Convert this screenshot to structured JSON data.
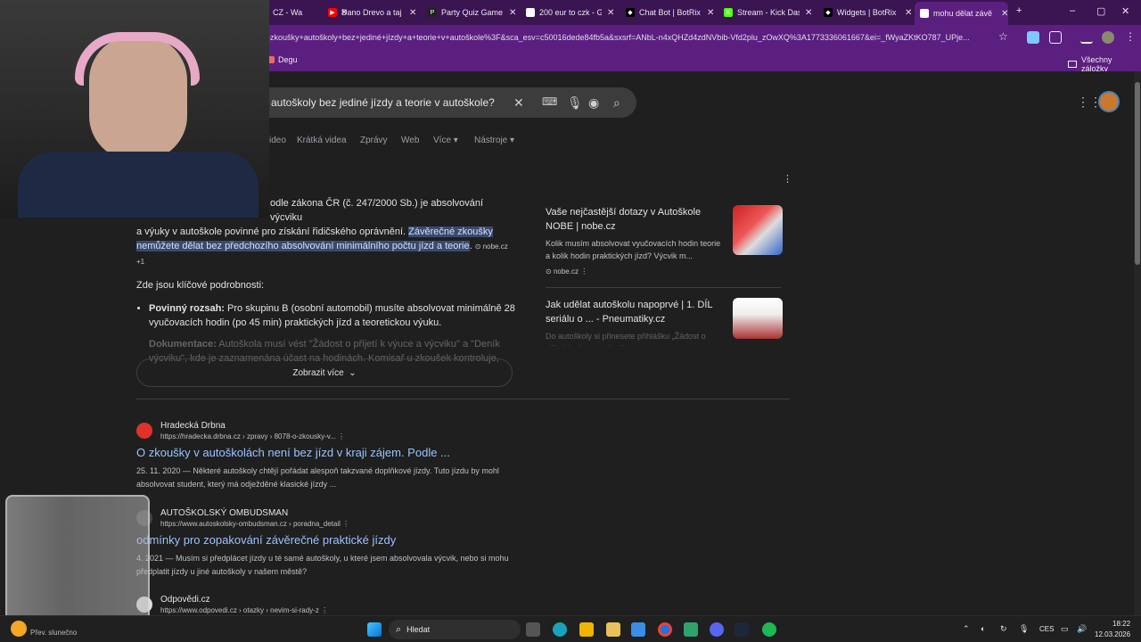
{
  "tabs": [
    {
      "title": "CZ - Wa",
      "color": "#6d4c8a",
      "glyph": ""
    },
    {
      "title": "Dano Drevo a taj",
      "color": "#ff0000",
      "glyph": "▶"
    },
    {
      "title": "Party Quiz Game",
      "color": "#222222",
      "glyph": "P"
    },
    {
      "title": "200 eur to czk - G",
      "color": "#ffffff",
      "glyph": "G"
    },
    {
      "title": "Chat Bot | BotRix",
      "color": "#000000",
      "glyph": "◆"
    },
    {
      "title": "Stream - Kick Das",
      "color": "#53fc18",
      "glyph": "K"
    },
    {
      "title": "Widgets | BotRix",
      "color": "#000000",
      "glyph": "◆"
    },
    {
      "title": "mohu dělat závě",
      "color": "#ffffff",
      "glyph": "G"
    }
  ],
  "new_tab_glyph": "+",
  "window_controls": [
    "–",
    "▢",
    "✕"
  ],
  "address_bar": {
    "url": "-zkoušky+autoškoly+bez+jediné+jízdy+a+teorie+v+autoškole%3F&sca_esv=c50016dede84fb5a&sxsrf=ANbL-n4xQHZd4zdNVbib-Vfd2plu_zOwXQ%3A1773336061667&ei=_fWyaZKtKO787_UPje..."
  },
  "bookmarks": {
    "left": "Degu",
    "right": "Všechny záložky"
  },
  "search": {
    "query": "autoškoly bez jediné jízdy a teorie v autoškole?"
  },
  "filters": [
    "ideo",
    "Krátká videa",
    "Zprávy",
    "Web",
    "Více",
    "Nástroje"
  ],
  "overview": {
    "line1": "odle zákona ČR (č. 247/2000 Sb.) je absolvování výcviku",
    "line2_plain": "a výuky v autoškole povinné pro získání řidičského oprávnění.",
    "highlight": "Závěrečné zkoušky nemůžete dělat bez předchozího absolvování minimálního počtu jízd a teorie",
    "highlight_end": ".",
    "source_chip": "nobe.cz +1",
    "subhead": "Zde jsou klíčové podrobnosti:",
    "bullets": [
      {
        "label": "Povinný rozsah:",
        "text": "Pro skupinu B (osobní automobil) musíte absolvovat minimálně 28 vyučovacích hodin (po 45 min) praktických jízd a teoretickou výuku."
      },
      {
        "label": "Dokumentace:",
        "text": "Autoškola musí vést \"Žádost o přijetí k výuce a výcviku\" a \"Deník výcviku\", kde je zaznamenána účast na hodinách. Komisař u zkoušek kontroluje, zda"
      }
    ],
    "show_more": "Zobrazit více"
  },
  "side_cards": [
    {
      "title": "Vaše nejčastější dotazy v Autoškole NOBE | nobe.cz",
      "snippet": "Kolik musím absolvovat vyučovacích hodin teorie a kolik hodin praktických jízd? Výcvik m...",
      "source": "nobe.cz"
    },
    {
      "title": "Jak udělat autoškolu napoprvé | 1. DÍL seriálu o ... - Pneumatiky.cz",
      "snippet": "Do autoškoly si přinesete přihlášku „Žádost o přijetí k výuce a výcviku..."
    }
  ],
  "results": [
    {
      "site": "Hradecká Drbna",
      "url": "https://hradecka.drbna.cz › zpravy › 8078-o-zkousky-v...",
      "title": "O zkoušky v autoškolách není bez jízd v kraji zájem. Podle ...",
      "snippet": "25. 11. 2020 — Některé autoškoly chtějí pořádat alespoň takzvané doplňkové jízdy. Tuto jízdu by mohl absolvovat student, který má odježděné klasické jízdy ..."
    },
    {
      "site": "AUTOŠKOLSKÝ OMBUDSMAN",
      "url": "https://www.autoskolsky-ombudsman.cz › poradna_detail",
      "title": "odmínky pro zopakování závěrečné praktické jízdy",
      "snippet": "4. 2021 — Musím si předplácet jízdy u té samé autoškoly, u které jsem absolvovala výcvik, nebo si mohu předplatit jízdy u jiné autoškoly v našem městě?"
    },
    {
      "site": "Odpovědi.cz",
      "url": "https://www.odpovedi.cz › otazky › nevim-si-rady-z",
      "title": "",
      "snippet": ""
    }
  ],
  "taskbar": {
    "weather": "Přev. slunečno",
    "search_label": "Hledat",
    "lang": "CES",
    "time": "18:22",
    "date": "12.03.2026"
  }
}
